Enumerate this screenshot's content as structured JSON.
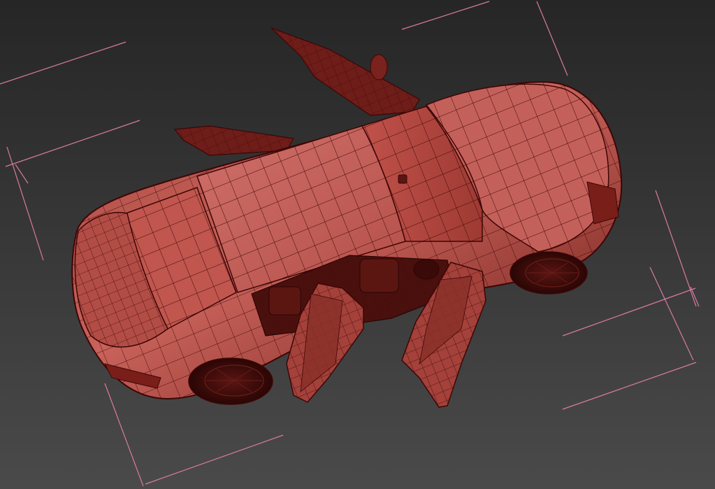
{
  "viewport": {
    "view": "perspective",
    "shading": "wireframe-over-shaded",
    "background_top": "#262626",
    "background_bottom": "#4a4a4a"
  },
  "model": {
    "kind": "sedan",
    "wire_color": "#3d0606",
    "body_color_light": "#c85a52",
    "body_color_dark": "#7a1e1a",
    "doors_open": 4
  },
  "bounding_box": {
    "color": "#d97aa0"
  }
}
